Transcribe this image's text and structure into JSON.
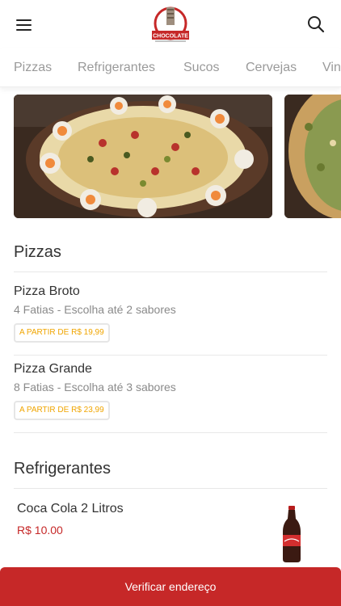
{
  "header": {
    "menu_icon": "hamburger-menu-icon",
    "logo_text": "CHOCOLATE",
    "search_icon": "search-icon"
  },
  "tabs": [
    {
      "label": "Pizzas"
    },
    {
      "label": "Refrigerantes"
    },
    {
      "label": "Sucos"
    },
    {
      "label": "Cervejas"
    },
    {
      "label": "Vinhos"
    }
  ],
  "sections": {
    "pizzas": {
      "title": "Pizzas",
      "items": [
        {
          "name": "Pizza Broto",
          "description": "4 Fatias - Escolha até 2 sabores",
          "price": "A PARTIR DE R$ 19,99"
        },
        {
          "name": "Pizza Grande",
          "description": "8 Fatias - Escolha até 3 sabores",
          "price": "A PARTIR DE R$ 23,99"
        }
      ]
    },
    "refrigerantes": {
      "title": "Refrigerantes",
      "items": [
        {
          "name": "Coca Cola 2 Litros",
          "price": "R$ 10.00"
        }
      ]
    }
  },
  "footer": {
    "button_label": "Verificar endereço"
  },
  "colors": {
    "accent": "#c62828",
    "price_badge_text": "#f0a500"
  }
}
